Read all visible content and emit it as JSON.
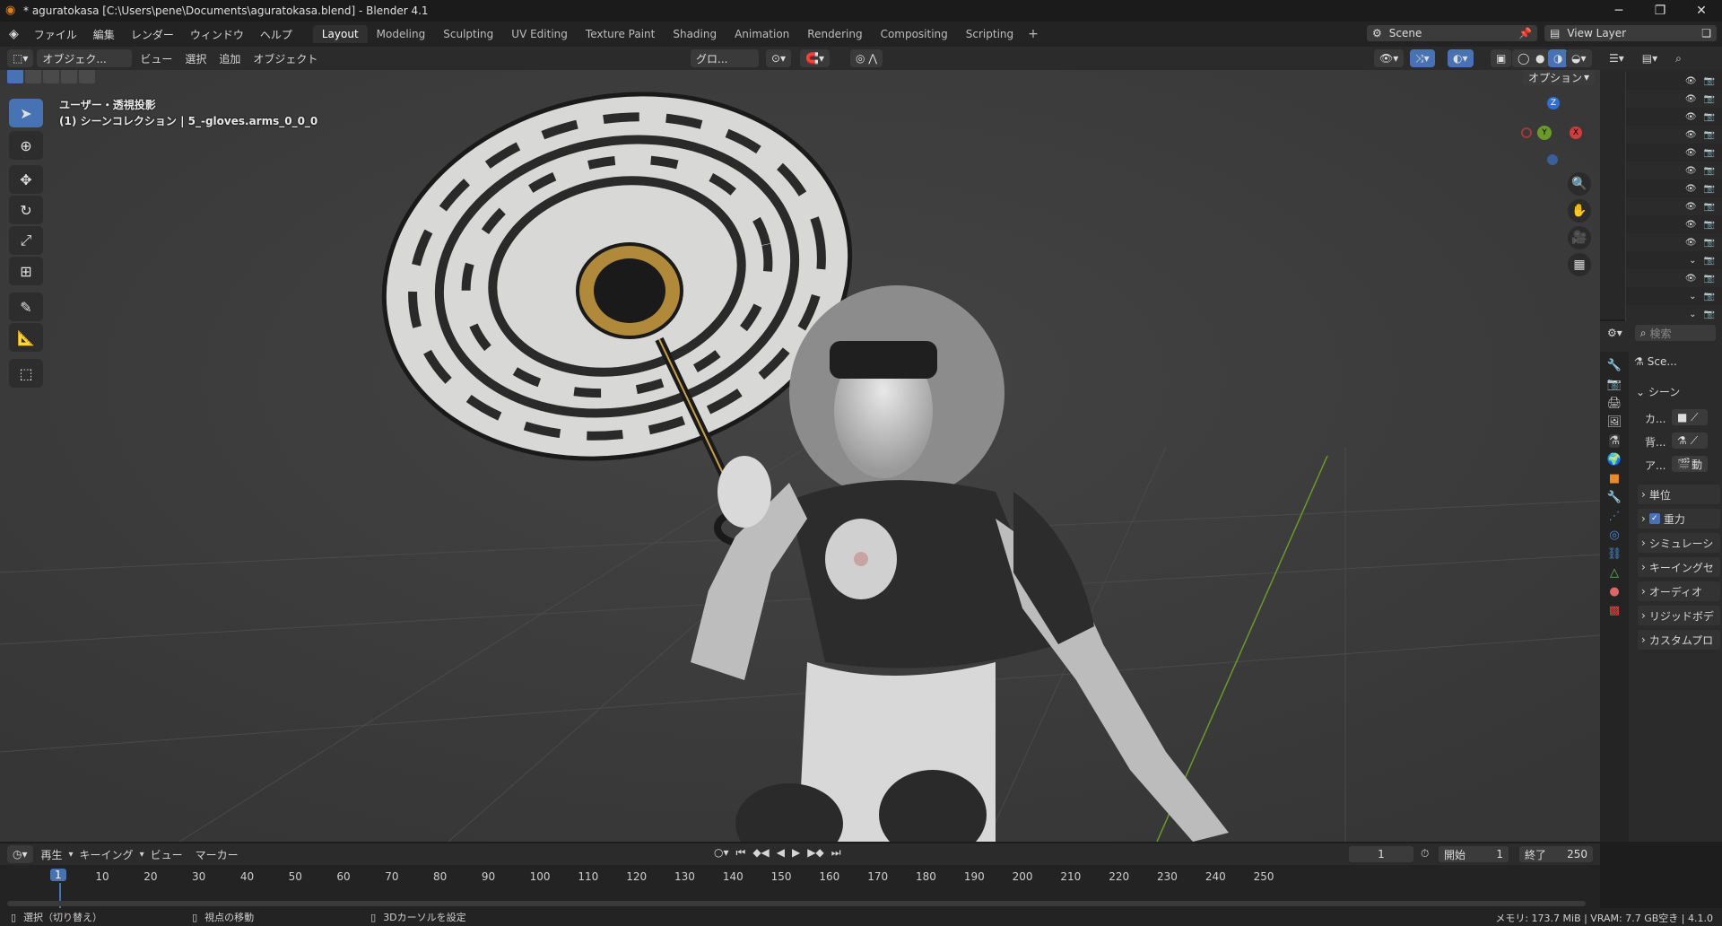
{
  "title": "* aguratokasa [C:\\Users\\pene\\Documents\\aguratokasa.blend] - Blender 4.1",
  "menus": [
    "ファイル",
    "編集",
    "レンダー",
    "ウィンドウ",
    "ヘルプ"
  ],
  "workspaces": [
    "Layout",
    "Modeling",
    "Sculpting",
    "UV Editing",
    "Texture Paint",
    "Shading",
    "Animation",
    "Rendering",
    "Compositing",
    "Scripting"
  ],
  "active_workspace": "Layout",
  "scene": "Scene",
  "view_layer": "View Layer",
  "viewport_header": {
    "mode": "オブジェク...",
    "menus": [
      "ビュー",
      "選択",
      "追加",
      "オブジェクト"
    ],
    "transform": "グロ...",
    "options": "オプション"
  },
  "viewport": {
    "line1": "ユーザー・透視投影",
    "line2": "(1) シーンコレクション | 5_-gloves.arms_0_0_0",
    "gizmo_z": "Z",
    "gizmo_y": "Y",
    "gizmo_x": "X"
  },
  "properties": {
    "search_placeholder": "検索",
    "scene_name": "Sce...",
    "section": "シーン",
    "rows": [
      {
        "label": "カ..."
      },
      {
        "label": "背..."
      },
      {
        "label": "ア..."
      }
    ],
    "subpanels": [
      "単位",
      "重力",
      "シミュレーシ",
      "キーイングセ",
      "オーディオ",
      "リジッドボデ",
      "カスタムプロ"
    ],
    "gravity_checked": true,
    "action_label": "動"
  },
  "timeline": {
    "menus": [
      "再生",
      "キーイング",
      "ビュー",
      "マーカー"
    ],
    "current_frame": "1",
    "start_label": "開始",
    "start": "1",
    "end_label": "終了",
    "end": "250",
    "ticks": [
      "1",
      "10",
      "20",
      "30",
      "40",
      "50",
      "60",
      "70",
      "80",
      "90",
      "100",
      "110",
      "120",
      "130",
      "140",
      "150",
      "160",
      "170",
      "180",
      "190",
      "200",
      "210",
      "220",
      "230",
      "240",
      "250"
    ]
  },
  "status": {
    "select": "選択（切り替え）",
    "move": "視点の移動",
    "cursor": "3Dカーソルを設定",
    "memory": "メモリ: 173.7 MiB | VRAM: 7.7 GB空き | 4.1.0"
  },
  "colors": {
    "accent": "#4772b3",
    "frame_marker": "#4772b3"
  }
}
